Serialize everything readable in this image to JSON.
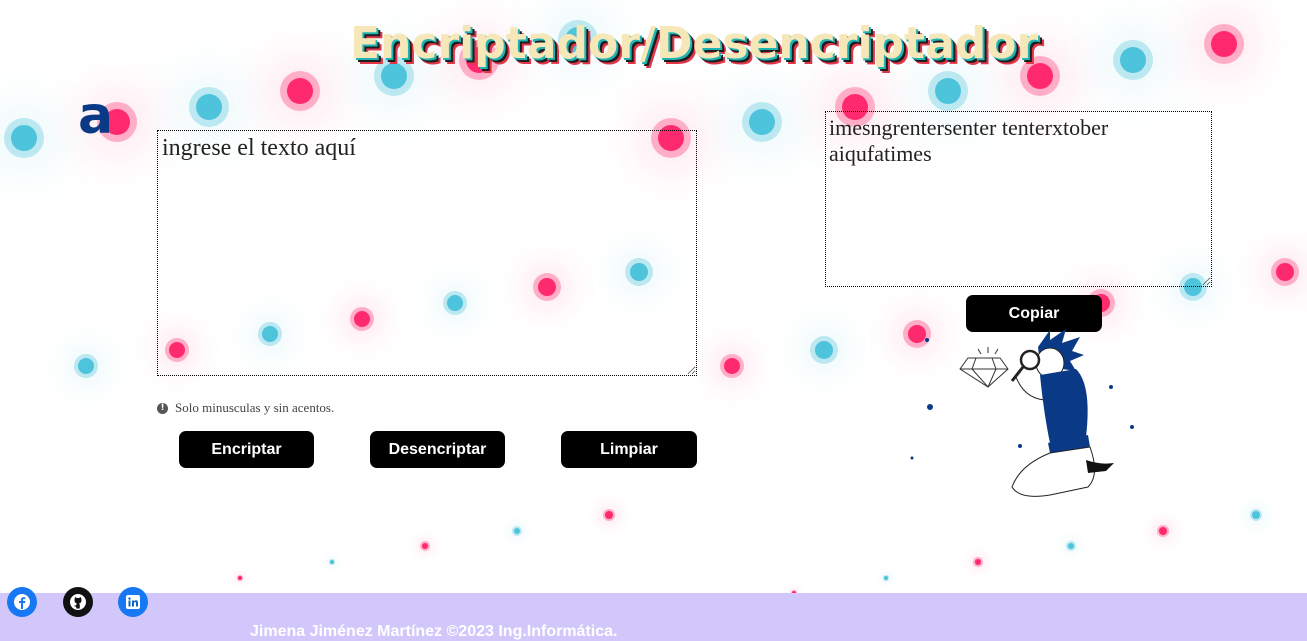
{
  "page": {
    "title": "Encriptador/Desencriptador",
    "logo_text": "a"
  },
  "input": {
    "placeholder": "ingrese el texto aquí",
    "value": ""
  },
  "output": {
    "value": "imesngrentersenter tenterxtober aiqufatimes"
  },
  "hint": {
    "icon": "info-icon",
    "text": "Solo minusculas y sin acentos."
  },
  "buttons": {
    "encrypt": "Encriptar",
    "decrypt": "Desencriptar",
    "clear": "Limpiar",
    "copy": "Copiar"
  },
  "footer": {
    "text": "Jimena Jiménez Martínez ©2023 Ing.Informática.",
    "social": [
      {
        "name": "facebook-icon",
        "color": "#1877f2"
      },
      {
        "name": "github-icon",
        "color": "#111111"
      },
      {
        "name": "linkedin-icon",
        "color": "#0a66c2"
      }
    ]
  },
  "colors": {
    "pink_dot": "#ff2a6d",
    "blue_dot": "#4ec3dc",
    "footer_bg": "#d2c7fb",
    "button_bg": "#000000"
  }
}
